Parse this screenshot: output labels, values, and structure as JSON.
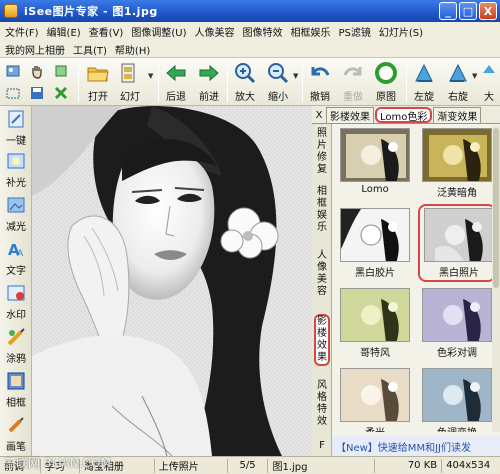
{
  "window": {
    "title": "iSee图片专家 - 图1.jpg",
    "min": "_",
    "max": "□",
    "close": "X"
  },
  "menu": {
    "row1": [
      "文件(F)",
      "编辑(E)",
      "查看(V)",
      "图像调整(U)",
      "人像美容",
      "图像特效",
      "相框娱乐",
      "PS滤镜",
      "幻灯片(S)"
    ],
    "row2": [
      "我的网上相册",
      "工具(T)",
      "帮助(H)"
    ]
  },
  "toolbar": {
    "open": "打开",
    "slideshow": "幻灯",
    "back": "后退",
    "forward": "前进",
    "zoom_in": "放大",
    "zoom_out": "缩小",
    "undo": "撤销",
    "redo": "重做",
    "original": "原图",
    "rotate_left": "左旋",
    "rotate_right": "右旋",
    "more": "大"
  },
  "left_tools": [
    "一键",
    "补光",
    "减光",
    "文字",
    "水印",
    "涂鸦",
    "相框",
    "画笔"
  ],
  "panel": {
    "close": "X",
    "tabs": [
      "影楼效果",
      "Lomo色彩",
      "渐变效果"
    ],
    "active_tab": "Lomo色彩",
    "vtabs": [
      "照片修复",
      "相框娱乐",
      "人像美容",
      "影楼效果",
      "风格特效",
      "F"
    ],
    "active_vtab": "影楼效果",
    "thumbs": [
      {
        "label": "Lomo",
        "tone": "warm"
      },
      {
        "label": "泛黄暗角",
        "tone": "yellow"
      },
      {
        "label": "黑白胶片",
        "tone": "bw"
      },
      {
        "label": "黑白照片",
        "tone": "gray"
      },
      {
        "label": "哥特风",
        "tone": "green"
      },
      {
        "label": "色彩对调",
        "tone": "purple"
      },
      {
        "label": "柔光",
        "tone": "soft"
      },
      {
        "label": "色调变换",
        "tone": "shift"
      }
    ],
    "selected_thumb": "黑白照片",
    "news": "【New】快速给MM和JJ们读发"
  },
  "status": {
    "items": [
      "前调",
      "学习",
      "淘宝相册",
      "上传照片"
    ],
    "page": "5/5",
    "file": "图1.jpg",
    "size": "70 KB",
    "dimensions": "404x534"
  },
  "watermark": "三联网 3LIAN.COM",
  "colors": {
    "accent": "#1f56c9",
    "highlight": "#d94444",
    "toolbar": "#efedde"
  }
}
